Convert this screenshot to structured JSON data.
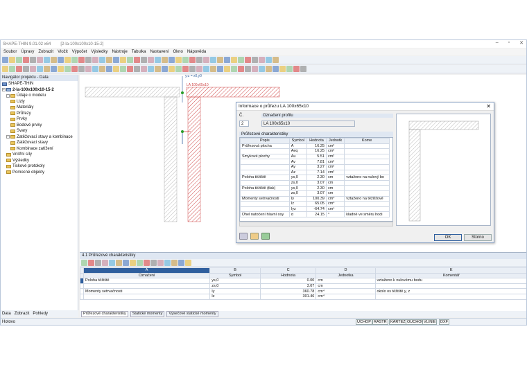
{
  "window": {
    "title": "SHAPE-THIN 9.01.02 x64",
    "doc": "[2-la-100x100x10-15-2]"
  },
  "menu": [
    "Soubor",
    "Úpravy",
    "Zobrazit",
    "Vložit",
    "Výpočet",
    "Výsledky",
    "Nástroje",
    "Tabulka",
    "Nastavení",
    "Okno",
    "Nápověda"
  ],
  "navigator": {
    "title": "Navigátor projektu - Data",
    "root": "SHAPE-THIN",
    "project": "2-la-100x100x10-15-2",
    "items": [
      "Údaje o modelu",
      "Uzly",
      "Materiály",
      "Průřezy",
      "Prvky",
      "Bodové prvky",
      "Svary",
      "Zatěžovací stavy a kombinace",
      "Zatěžovací stavy",
      "Kombinace zatížení",
      "Vnitřní síly",
      "Výsledky",
      "Tiskové protokoly",
      "Pomocné objekty"
    ],
    "tabs": [
      "Data",
      "Zobrazit",
      "Pohledy"
    ]
  },
  "canvas": {
    "label1": "LA 100x65x10",
    "label2": "LA 100x65x10",
    "axis": "y,u = x0,y0"
  },
  "dialog": {
    "title": "Informace o průřezu LA 100x65x10",
    "no_label": "Č.",
    "no_value": "2",
    "profile_label": "Označení profilu",
    "profile_value": "LA 100x65x10",
    "props_header": "Průřezové charakteristiky",
    "cols": [
      "Popis",
      "Symbol",
      "Hodnota",
      "Jednotk",
      "Kome"
    ],
    "rows": [
      [
        "Průřezová plocha",
        "A",
        "16.25",
        "cm²",
        ""
      ],
      [
        "",
        "Aeq",
        "16.25",
        "cm²",
        ""
      ],
      [
        "Smykové plochy",
        "Au",
        "5.51",
        "cm²",
        ""
      ],
      [
        "",
        "Av",
        "7.81",
        "cm²",
        ""
      ],
      [
        "",
        "Ay",
        "3.27",
        "cm²",
        ""
      ],
      [
        "",
        "Az",
        "7.14",
        "cm²",
        ""
      ],
      [
        "Poloha těžiště",
        "ys,0",
        "2.30",
        "cm",
        "vztaženo na nulový bo"
      ],
      [
        "",
        "zs,0",
        "3.07",
        "cm",
        ""
      ],
      [
        "Poloha těžiště (tlak)",
        "ys,0",
        "2.30",
        "cm",
        ""
      ],
      [
        "",
        "zs,0",
        "3.07",
        "cm",
        ""
      ],
      [
        "Momenty setrvačnosti",
        "Iy",
        "100.39",
        "cm⁴",
        "vztaženo na těžišťové"
      ],
      [
        "",
        "Iz",
        "65.05",
        "cm⁴",
        ""
      ],
      [
        "",
        "Iyz",
        "-64.74",
        "cm⁴",
        ""
      ],
      [
        "Úhel natočení hlavní osy",
        "α",
        "24.15",
        "°",
        "kladně ve směru hodi"
      ]
    ],
    "ok": "OK",
    "cancel": "Storno"
  },
  "panel": {
    "title": "4.1 Průřezové charakteristiky",
    "col_letters": [
      "A",
      "B",
      "C",
      "D",
      "E"
    ],
    "cols": [
      "Označení",
      "Symbol",
      "Hodnota",
      "Jednotka",
      "Komentář"
    ],
    "rows": [
      [
        "Poloha těžiště",
        "ys,0",
        "0.00",
        "cm",
        "vztaženo k nulovému bodu"
      ],
      [
        "",
        "zs,0",
        "3.07",
        "cm",
        ""
      ],
      [
        "Momenty setrvačnosti",
        "Iy",
        "360.78",
        "cm⁴",
        "okolo os těžiště y, z"
      ],
      [
        "",
        "Iz",
        "301.46",
        "cm⁴",
        ""
      ]
    ],
    "tabs": [
      "Průřezové charakteristiky",
      "Statické momenty",
      "Výsečové statické momenty"
    ]
  },
  "status": {
    "text": "Hotovo",
    "buttons": [
      "UCHOP",
      "RASTR",
      "KARTEZ",
      "OUCHOP",
      "VLINIE",
      "DXF"
    ]
  },
  "colors": {
    "accent": "#2f5f9e",
    "hatch": "#d04a4a"
  }
}
